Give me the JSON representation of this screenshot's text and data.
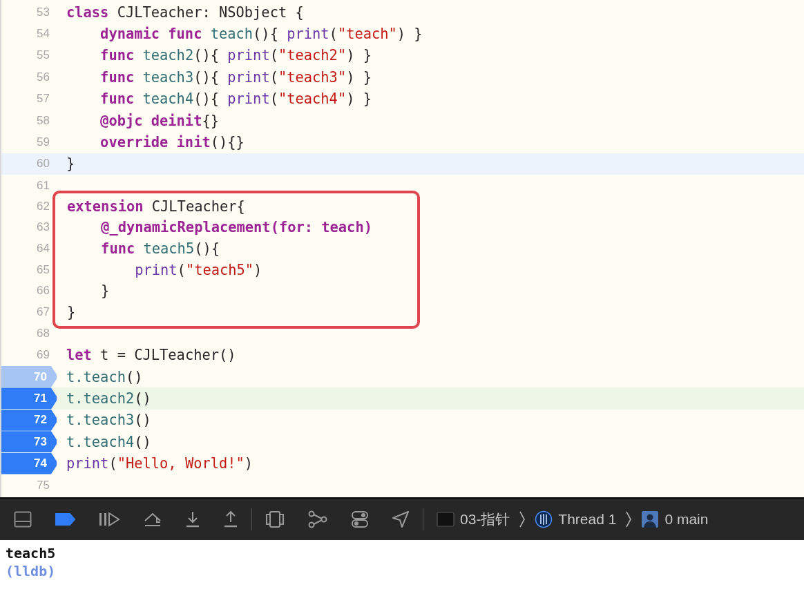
{
  "editor": {
    "blocks": [
      {
        "boxed": false,
        "lines": [
          {
            "number": "53",
            "tokens": [
              {
                "kind": "kw",
                "text": "class"
              },
              {
                "kind": "plain",
                "text": " CJLTeacher: NSObject {"
              }
            ]
          },
          {
            "number": "54",
            "tokens": [
              {
                "kind": "kw",
                "text": "    dynamic func "
              },
              {
                "kind": "name",
                "text": "teach"
              },
              {
                "kind": "plain",
                "text": "(){ "
              },
              {
                "kind": "fn",
                "text": "print"
              },
              {
                "kind": "plain",
                "text": "("
              },
              {
                "kind": "str",
                "text": "\"teach\""
              },
              {
                "kind": "plain",
                "text": ") }"
              }
            ]
          },
          {
            "number": "55",
            "tokens": [
              {
                "kind": "kw",
                "text": "    func "
              },
              {
                "kind": "name",
                "text": "teach2"
              },
              {
                "kind": "plain",
                "text": "(){ "
              },
              {
                "kind": "fn",
                "text": "print"
              },
              {
                "kind": "plain",
                "text": "("
              },
              {
                "kind": "str",
                "text": "\"teach2\""
              },
              {
                "kind": "plain",
                "text": ") }"
              }
            ]
          },
          {
            "number": "56",
            "tokens": [
              {
                "kind": "kw",
                "text": "    func "
              },
              {
                "kind": "name",
                "text": "teach3"
              },
              {
                "kind": "plain",
                "text": "(){ "
              },
              {
                "kind": "fn",
                "text": "print"
              },
              {
                "kind": "plain",
                "text": "("
              },
              {
                "kind": "str",
                "text": "\"teach3\""
              },
              {
                "kind": "plain",
                "text": ") }"
              }
            ]
          },
          {
            "number": "57",
            "tokens": [
              {
                "kind": "kw",
                "text": "    func "
              },
              {
                "kind": "name",
                "text": "teach4"
              },
              {
                "kind": "plain",
                "text": "(){ "
              },
              {
                "kind": "fn",
                "text": "print"
              },
              {
                "kind": "plain",
                "text": "("
              },
              {
                "kind": "str",
                "text": "\"teach4\""
              },
              {
                "kind": "plain",
                "text": ") }"
              }
            ]
          },
          {
            "number": "58",
            "tokens": [
              {
                "kind": "kw",
                "text": "    @objc deinit"
              },
              {
                "kind": "plain",
                "text": "{}"
              }
            ]
          },
          {
            "number": "59",
            "tokens": [
              {
                "kind": "kw",
                "text": "    override init"
              },
              {
                "kind": "plain",
                "text": "(){}"
              }
            ]
          },
          {
            "number": "60",
            "cursor": true,
            "tokens": [
              {
                "kind": "plain",
                "text": "}"
              }
            ]
          },
          {
            "number": "61"
          }
        ]
      },
      {
        "boxed": true,
        "lines": [
          {
            "number": "62",
            "tokens": [
              {
                "kind": "kw",
                "text": "extension"
              },
              {
                "kind": "plain",
                "text": " CJLTeacher{"
              }
            ]
          },
          {
            "number": "63",
            "tokens": [
              {
                "kind": "kw",
                "text": "    @_dynamicReplacement(for: teach)"
              }
            ]
          },
          {
            "number": "64",
            "tokens": [
              {
                "kind": "kw",
                "text": "    func "
              },
              {
                "kind": "name",
                "text": "teach5"
              },
              {
                "kind": "plain",
                "text": "(){"
              }
            ]
          },
          {
            "number": "65",
            "tokens": [
              {
                "kind": "fn",
                "text": "        print"
              },
              {
                "kind": "plain",
                "text": "("
              },
              {
                "kind": "str",
                "text": "\"teach5\""
              },
              {
                "kind": "plain",
                "text": ")"
              }
            ]
          },
          {
            "number": "66",
            "tokens": [
              {
                "kind": "plain",
                "text": "    }"
              }
            ]
          },
          {
            "number": "67",
            "tokens": [
              {
                "kind": "plain",
                "text": "}"
              }
            ]
          }
        ]
      },
      {
        "boxed": false,
        "lines": [
          {
            "number": "68"
          },
          {
            "number": "69",
            "tokens": [
              {
                "kind": "kw",
                "text": "let"
              },
              {
                "kind": "plain",
                "text": " t = CJLTeacher()"
              }
            ]
          },
          {
            "number": "70",
            "breakpoint": {
              "enabled": false
            },
            "tokens": [
              {
                "kind": "call",
                "text": "t.teach"
              },
              {
                "kind": "plain",
                "text": "()"
              }
            ]
          },
          {
            "number": "71",
            "breakpoint": {
              "enabled": true
            },
            "executing": true,
            "tokens": [
              {
                "kind": "call",
                "text": "t.teach2"
              },
              {
                "kind": "plain",
                "text": "()"
              }
            ]
          },
          {
            "number": "72",
            "breakpoint": {
              "enabled": true
            },
            "tokens": [
              {
                "kind": "call",
                "text": "t.teach3"
              },
              {
                "kind": "plain",
                "text": "()"
              }
            ]
          },
          {
            "number": "73",
            "breakpoint": {
              "enabled": true
            },
            "tokens": [
              {
                "kind": "call",
                "text": "t.teach4"
              },
              {
                "kind": "plain",
                "text": "()"
              }
            ]
          },
          {
            "number": "74",
            "breakpoint": {
              "enabled": true
            },
            "tokens": [
              {
                "kind": "fn",
                "text": "print"
              },
              {
                "kind": "plain",
                "text": "("
              },
              {
                "kind": "str",
                "text": "\"Hello, World!\""
              },
              {
                "kind": "plain",
                "text": ")"
              }
            ]
          },
          {
            "number": "75"
          }
        ]
      }
    ]
  },
  "debug_bar": {
    "breakpoints_active": true,
    "breadcrumb": [
      {
        "kind": "target",
        "label": "03-指针"
      },
      {
        "kind": "thread",
        "label": "Thread 1"
      },
      {
        "kind": "frame",
        "label": "0 main"
      }
    ]
  },
  "console": [
    {
      "kind": "output",
      "text": "teach5"
    },
    {
      "kind": "prompt",
      "text": "(lldb)"
    }
  ]
}
